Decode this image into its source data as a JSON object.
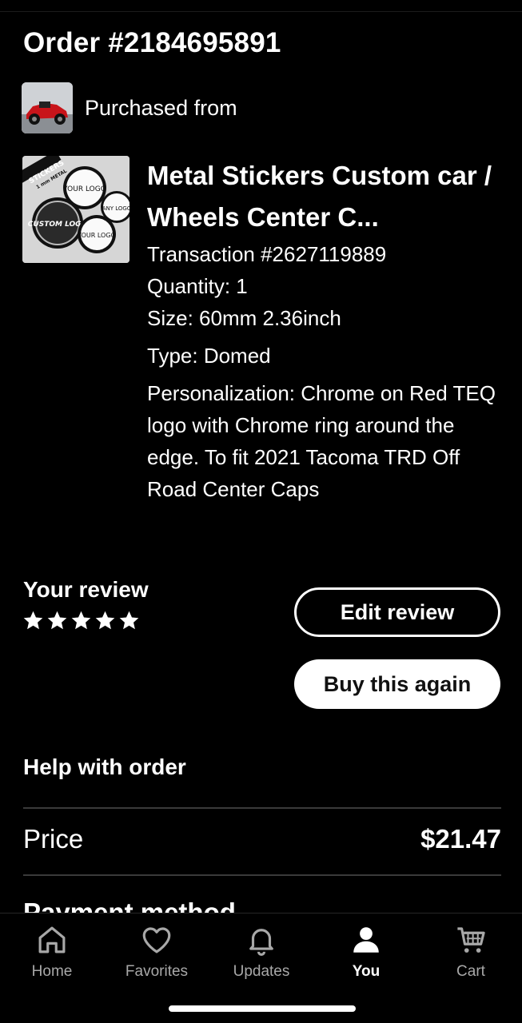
{
  "order": {
    "title": "Order #2184695891"
  },
  "shop": {
    "label": "Purchased from"
  },
  "product": {
    "title": "Metal Stickers Custom car / Wheels Center C...",
    "transaction": "Transaction #2627119889",
    "quantity": "Quantity: 1",
    "size": "Size: 60mm 2.36inch",
    "type": "Type: Domed",
    "personalization": "Personalization: Chrome on Red TEQ logo with Chrome ring around the edge. To fit 2021 Tacoma TRD Off Road Center Caps",
    "thumb_text": {
      "stickers": "STICKERS",
      "metal": "1 mm METAL",
      "your_logo": "YOUR LOGO",
      "any_logo": "ANY LOGO",
      "custom_logo": "CUSTOM LOGO",
      "your_logo2": "YOUR LOGO"
    }
  },
  "review": {
    "label": "Your review",
    "rating": 5,
    "edit_label": "Edit review",
    "buy_again_label": "Buy this again"
  },
  "help": {
    "label": "Help with order"
  },
  "price": {
    "label": "Price",
    "value": "$21.47"
  },
  "payment": {
    "label": "Payment method"
  },
  "tabs": [
    {
      "label": "Home",
      "icon": "home-icon"
    },
    {
      "label": "Favorites",
      "icon": "heart-icon"
    },
    {
      "label": "Updates",
      "icon": "bell-icon"
    },
    {
      "label": "You",
      "icon": "user-icon",
      "active": true
    },
    {
      "label": "Cart",
      "icon": "cart-icon"
    }
  ],
  "colors": {
    "background": "#000000",
    "text": "#ffffff",
    "muted": "#a8a8a8"
  }
}
